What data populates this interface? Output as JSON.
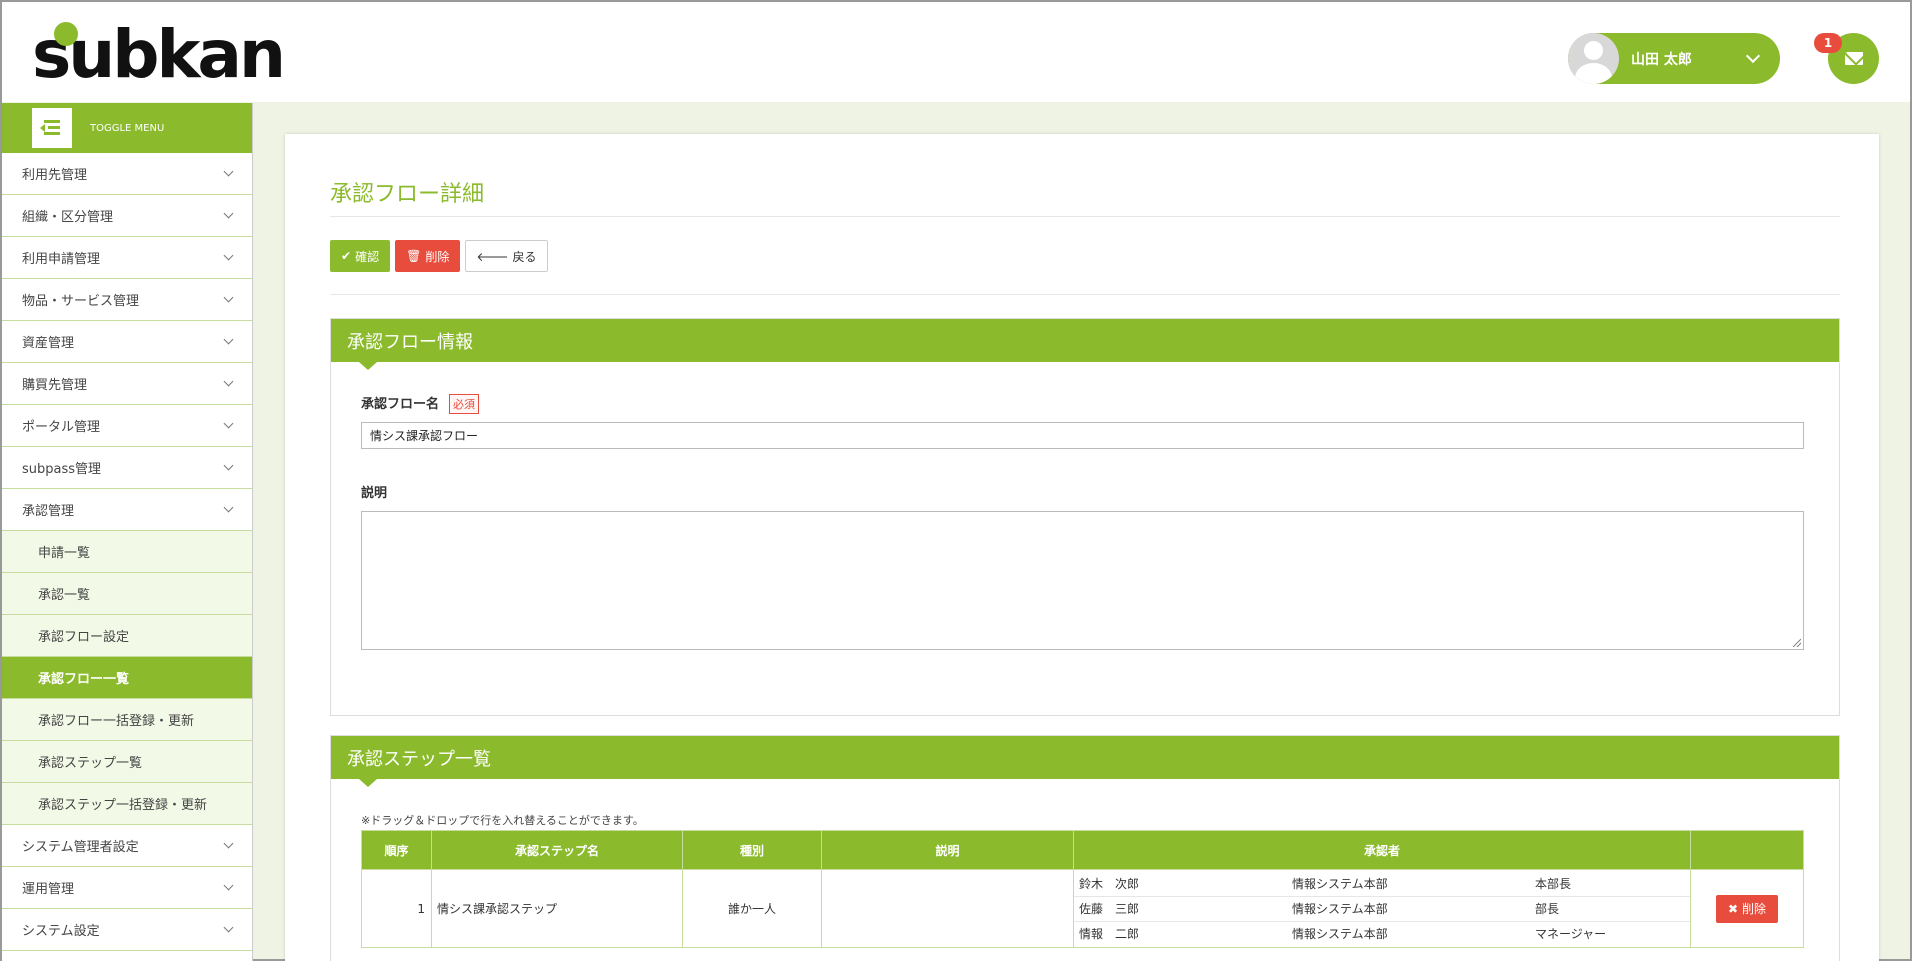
{
  "header": {
    "logo_text": "subkan",
    "user_name": "山田 太郎",
    "mail_badge": "1"
  },
  "sidebar": {
    "toggle_label": "TOGGLE MENU",
    "items": [
      {
        "label": "利用先管理"
      },
      {
        "label": "組織・区分管理"
      },
      {
        "label": "利用申請管理"
      },
      {
        "label": "物品・サービス管理"
      },
      {
        "label": "資産管理"
      },
      {
        "label": "購買先管理"
      },
      {
        "label": "ポータル管理"
      },
      {
        "label": "subpass管理"
      },
      {
        "label": "承認管理"
      }
    ],
    "sub_items": [
      {
        "label": "申請一覧"
      },
      {
        "label": "承認一覧"
      },
      {
        "label": "承認フロー設定"
      },
      {
        "label": "承認フロー一覧"
      },
      {
        "label": "承認フロー一括登録・更新"
      },
      {
        "label": "承認ステップ一覧"
      },
      {
        "label": "承認ステップ一括登録・更新"
      }
    ],
    "items_after": [
      {
        "label": "システム管理者設定"
      },
      {
        "label": "運用管理"
      },
      {
        "label": "システム設定"
      }
    ]
  },
  "main": {
    "title": "承認フロー詳細",
    "buttons": {
      "confirm": "確認",
      "delete": "削除",
      "back": "戻る"
    },
    "info_panel": {
      "heading": "承認フロー情報",
      "name_label": "承認フロー名",
      "required": "必須",
      "name_value": "情シス課承認フロー",
      "desc_label": "説明",
      "desc_value": ""
    },
    "steps_panel": {
      "heading": "承認ステップ一覧",
      "note": "※ドラッグ＆ドロップで行を入れ替えることができます。",
      "columns": [
        "順序",
        "承認ステップ名",
        "種別",
        "説明",
        "承認者",
        ""
      ],
      "rows": [
        {
          "order": "1",
          "name": "情シス課承認ステップ",
          "type": "誰か一人",
          "desc": "",
          "approvers": [
            {
              "name": "鈴木　次郎",
              "dept": "情報システム本部",
              "title": "本部長"
            },
            {
              "name": "佐藤　三郎",
              "dept": "情報システム本部",
              "title": "部長"
            },
            {
              "name": "情報　二郎",
              "dept": "情報システム本部",
              "title": "マネージャー"
            }
          ],
          "delete_label": "削除"
        }
      ]
    }
  },
  "colors": {
    "brand": "#8bbb2c",
    "danger": "#e74c3c"
  }
}
